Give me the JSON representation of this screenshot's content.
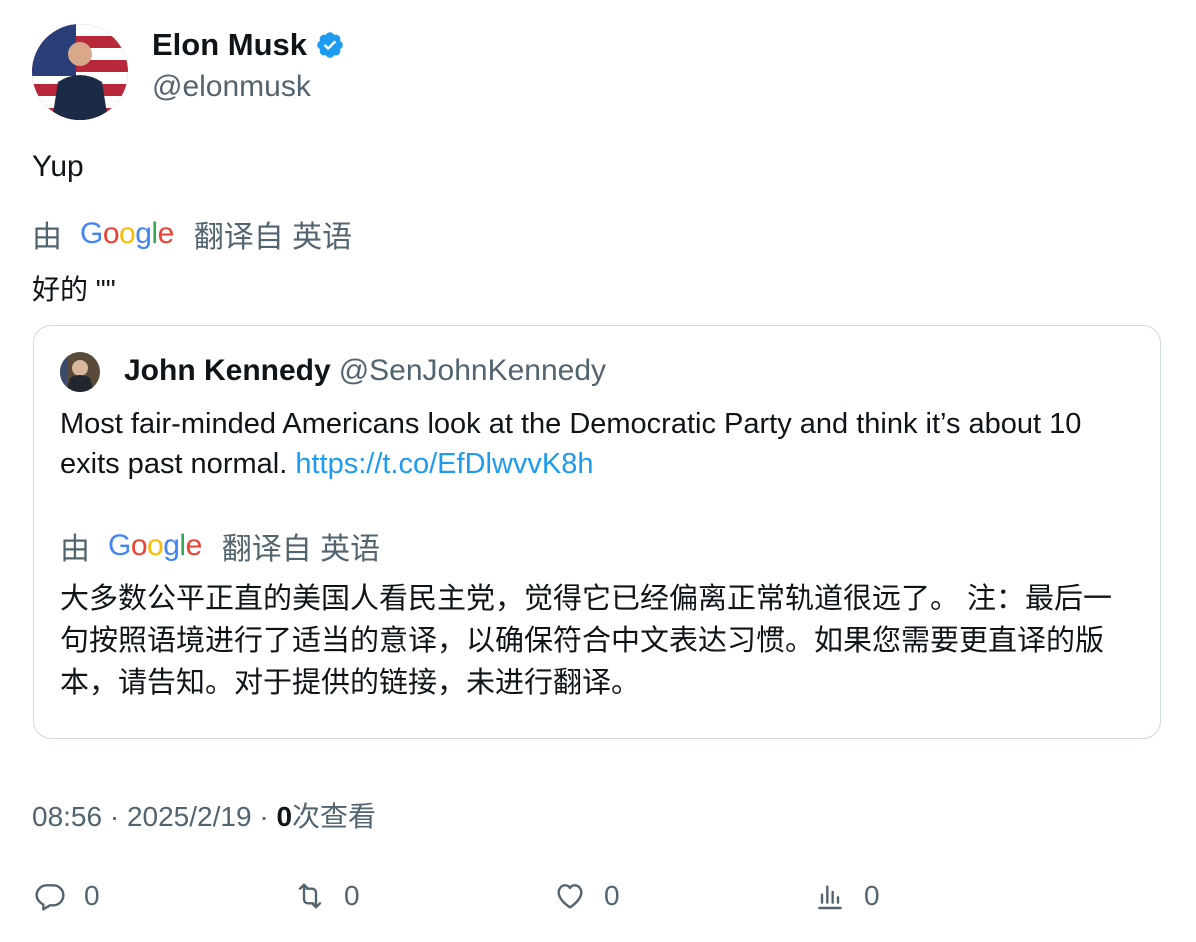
{
  "author": {
    "name": "Elon Musk",
    "handle": "@elonmusk",
    "verified_color": "#1d9bf0"
  },
  "tweet": {
    "text": "Yup",
    "translation_by": "由",
    "translation_provider": "Google",
    "translation_label": "翻译自 英语",
    "translated_text": "好的 \"\""
  },
  "quote": {
    "name": "John Kennedy",
    "handle": "@SenJohnKennedy",
    "text": "Most fair-minded Americans look at the Democratic Party and think it’s about 10 exits past normal.",
    "link": "https://t.co/EfDlwvvK8h",
    "translation_by": "由",
    "translation_provider": "Google",
    "translation_label": "翻译自 英语",
    "translated_text": "大多数公平正直的美国人看民主党，觉得它已经偏离正常轨道很远了。 注：最后一句按照语境进行了适当的意译，以确保符合中文表达习惯。如果您需要更直译的版本，请告知。对于提供的链接，未进行翻译。"
  },
  "meta": {
    "time": "08:56",
    "separator": "·",
    "date": "2025/2/19",
    "views_count": "0",
    "views_label": "次查看"
  },
  "actions": {
    "replies": "0",
    "retweets": "0",
    "likes": "0",
    "views": "0"
  },
  "colors": {
    "accent": "#1d9bf0",
    "secondary_text": "#536471",
    "border": "#cfd9de"
  },
  "icons": [
    "verified-badge-icon",
    "reply-icon",
    "retweet-icon",
    "like-icon",
    "views-icon"
  ]
}
